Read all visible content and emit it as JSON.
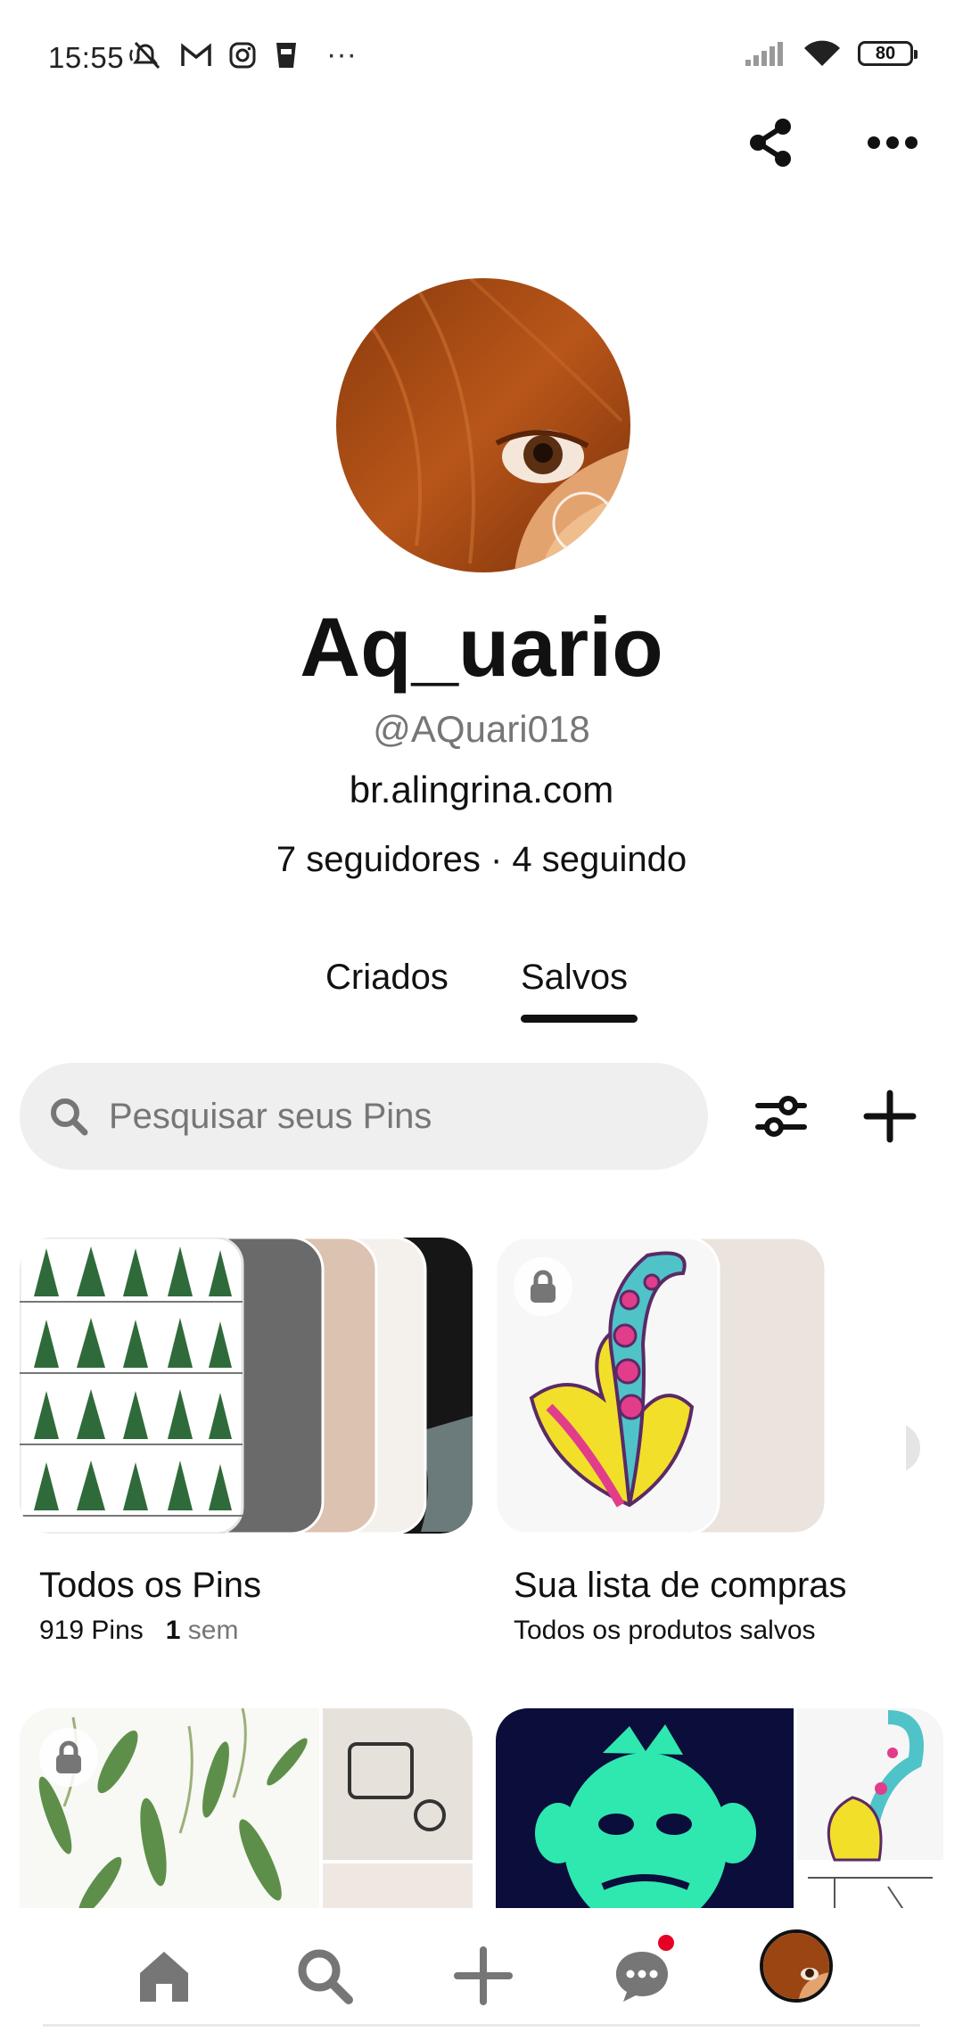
{
  "status_bar": {
    "time": "15:55",
    "more": "···",
    "battery": "80",
    "icons": [
      "mute-icon",
      "gmail-icon",
      "instagram-icon",
      "cup-icon",
      "signal-icon",
      "wifi-icon",
      "battery-icon"
    ]
  },
  "header": {
    "icons": [
      "share-icon",
      "more-options-icon"
    ]
  },
  "profile": {
    "display_name": "Aq_uario",
    "username": "@AQuari018",
    "website": "br.alingrina.com",
    "stats": "7 seguidores · 4 seguindo"
  },
  "tabs": [
    {
      "label": "Criados",
      "active": false
    },
    {
      "label": "Salvos",
      "active": true
    }
  ],
  "search": {
    "placeholder": "Pesquisar seus Pins"
  },
  "boards": [
    {
      "name": "Todos os Pins",
      "count": "919 Pins",
      "time_num": "1",
      "time_unit": "sem",
      "locked": false
    },
    {
      "name": "Sua lista de compras",
      "subtitle": "Todos os produtos salvos",
      "locked": true
    },
    {
      "locked": true
    },
    {
      "locked": false
    }
  ],
  "colors": {
    "accent": "#e60023",
    "text": "#111111",
    "muted": "#767676",
    "search_bg": "#efefef"
  },
  "bottom_nav": {
    "items": [
      "home-icon",
      "search-icon",
      "create-icon",
      "messages-icon",
      "profile-avatar"
    ]
  }
}
